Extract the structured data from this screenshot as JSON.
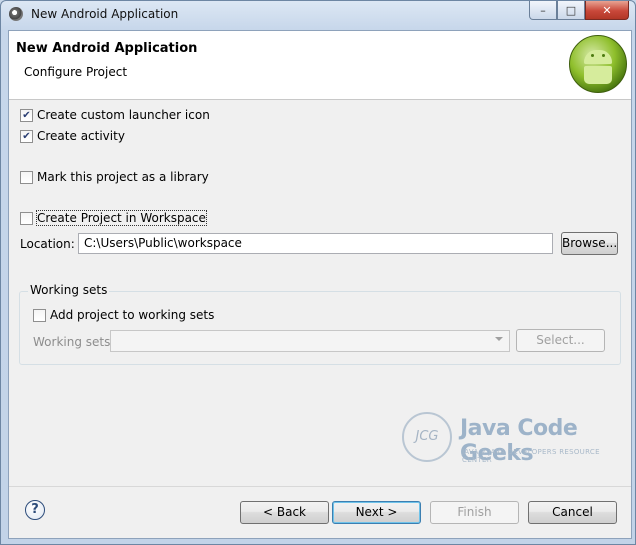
{
  "window": {
    "title": "New Android Application",
    "close_glyph": "✕",
    "min_glyph": "–",
    "max_glyph": "□"
  },
  "banner": {
    "title": "New Android Application",
    "subtitle": "Configure Project"
  },
  "options": {
    "launcher_icon": {
      "label": "Create custom launcher icon",
      "checked": true
    },
    "create_activity": {
      "label": "Create activity",
      "checked": true
    },
    "library": {
      "label": "Mark this project as a library",
      "checked": false
    },
    "workspace": {
      "label": "Create Project in Workspace",
      "checked": false
    }
  },
  "location": {
    "label": "Location:",
    "value": "C:\\Users\\Public\\workspace",
    "browse_label": "Browse..."
  },
  "working_sets": {
    "group_title": "Working sets",
    "add_label": "Add project to working sets",
    "add_checked": false,
    "sets_label": "Working sets:",
    "select_label": "Select..."
  },
  "watermark": {
    "name": "Java Code Geeks",
    "tagline": "JAVA 2 JAVA DEVELOPERS RESOURCE CENTER",
    "badge": "JCG"
  },
  "footer": {
    "help": "?",
    "back": "< Back",
    "next": "Next >",
    "finish": "Finish",
    "cancel": "Cancel"
  },
  "colors": {
    "title_bar": "#c6d6ea",
    "client_bg": "#f0f0f0",
    "close_button": "#c9483a",
    "android_green": "#8fbf2c"
  }
}
